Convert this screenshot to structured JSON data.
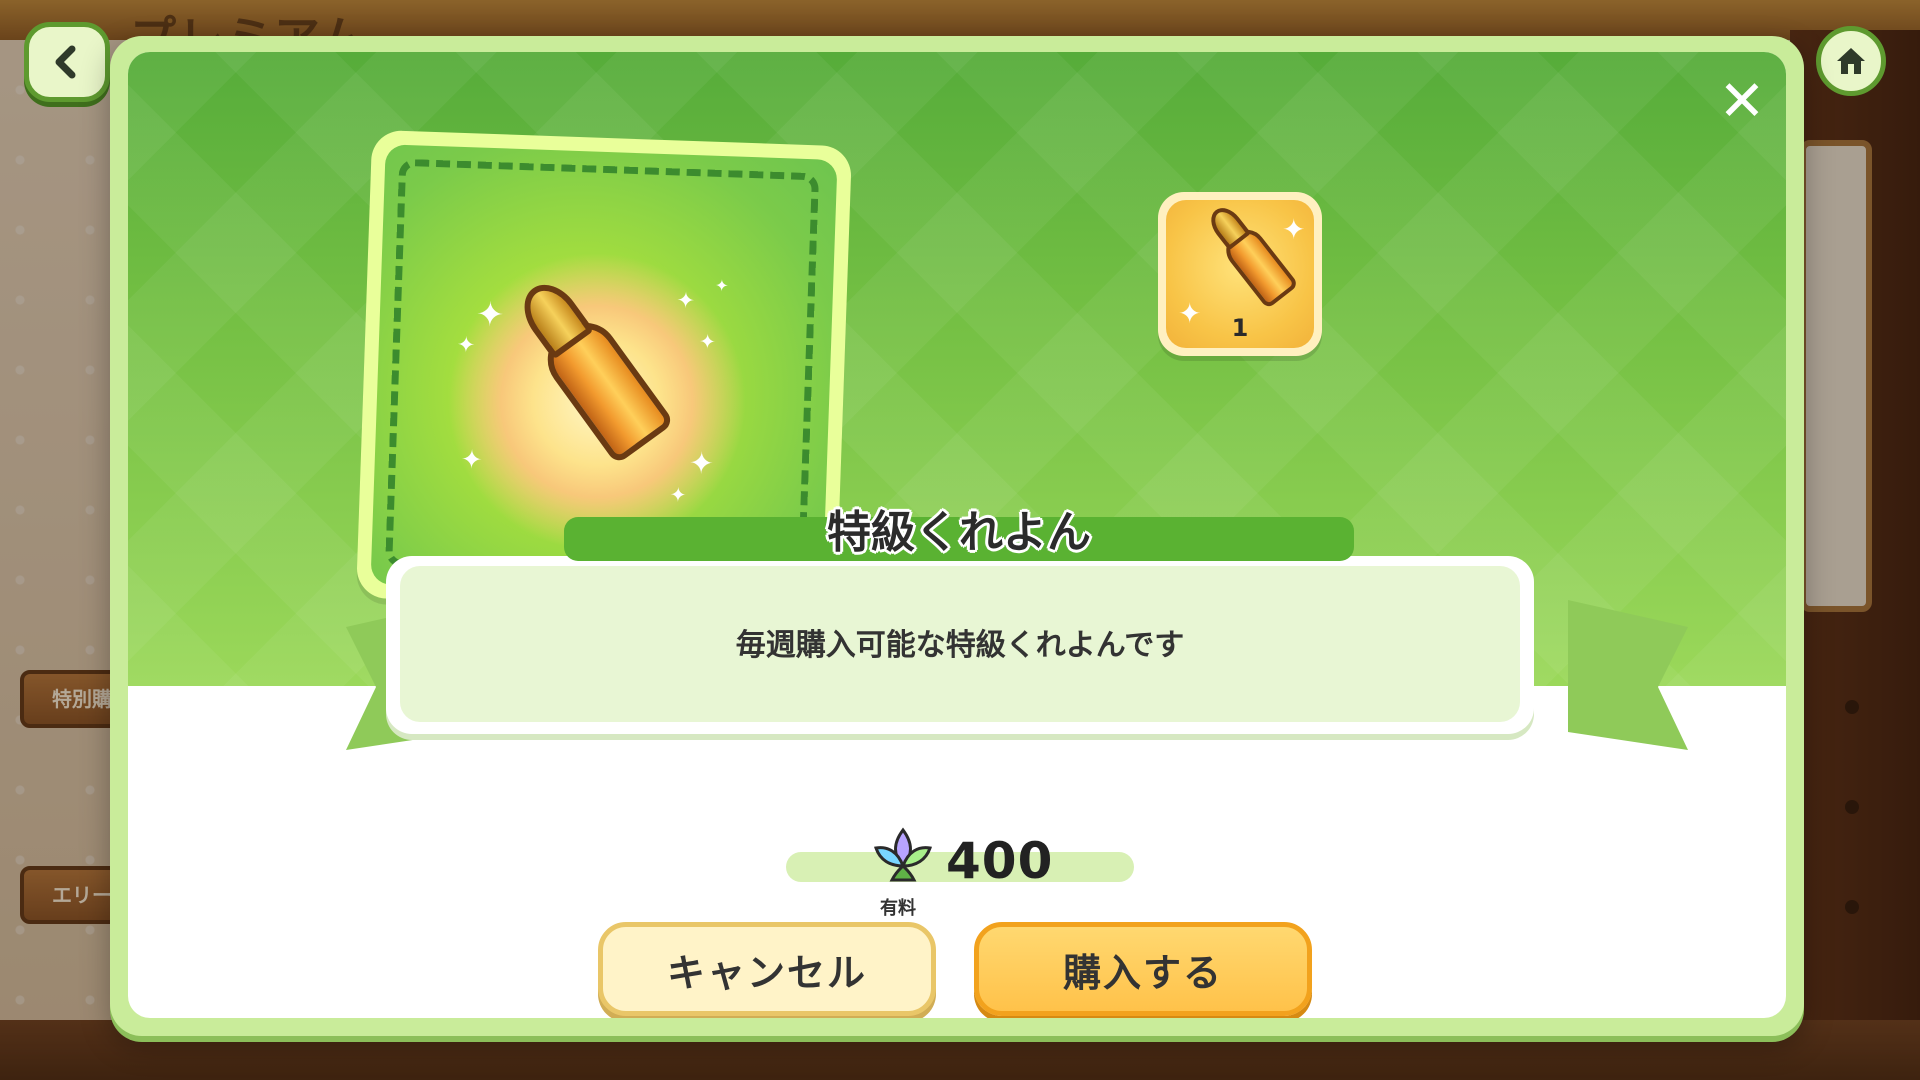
{
  "background": {
    "screen_title": "プレミアム",
    "left_signs": [
      "特別購",
      "エリー"
    ]
  },
  "nav": {
    "back_icon": "chevron-left-icon",
    "home_icon": "home-icon"
  },
  "dialog": {
    "close_label": "✕",
    "item": {
      "name": "特級くれよん",
      "description": "毎週購入可能な特級くれよんです",
      "quantity": "1",
      "icon": "golden-crayon-icon"
    },
    "price": {
      "currency_icon": "paid-gem-icon",
      "currency_label": "有料",
      "amount": "400"
    },
    "buttons": {
      "cancel_label": "キャンセル",
      "buy_label": "購入する"
    }
  },
  "colors": {
    "dialog_green": "#73bf43",
    "dialog_border": "#c9ec9a",
    "buy_button": "#ffc24a",
    "cancel_button": "#fff3c8",
    "title_bar": "#5ab232"
  }
}
